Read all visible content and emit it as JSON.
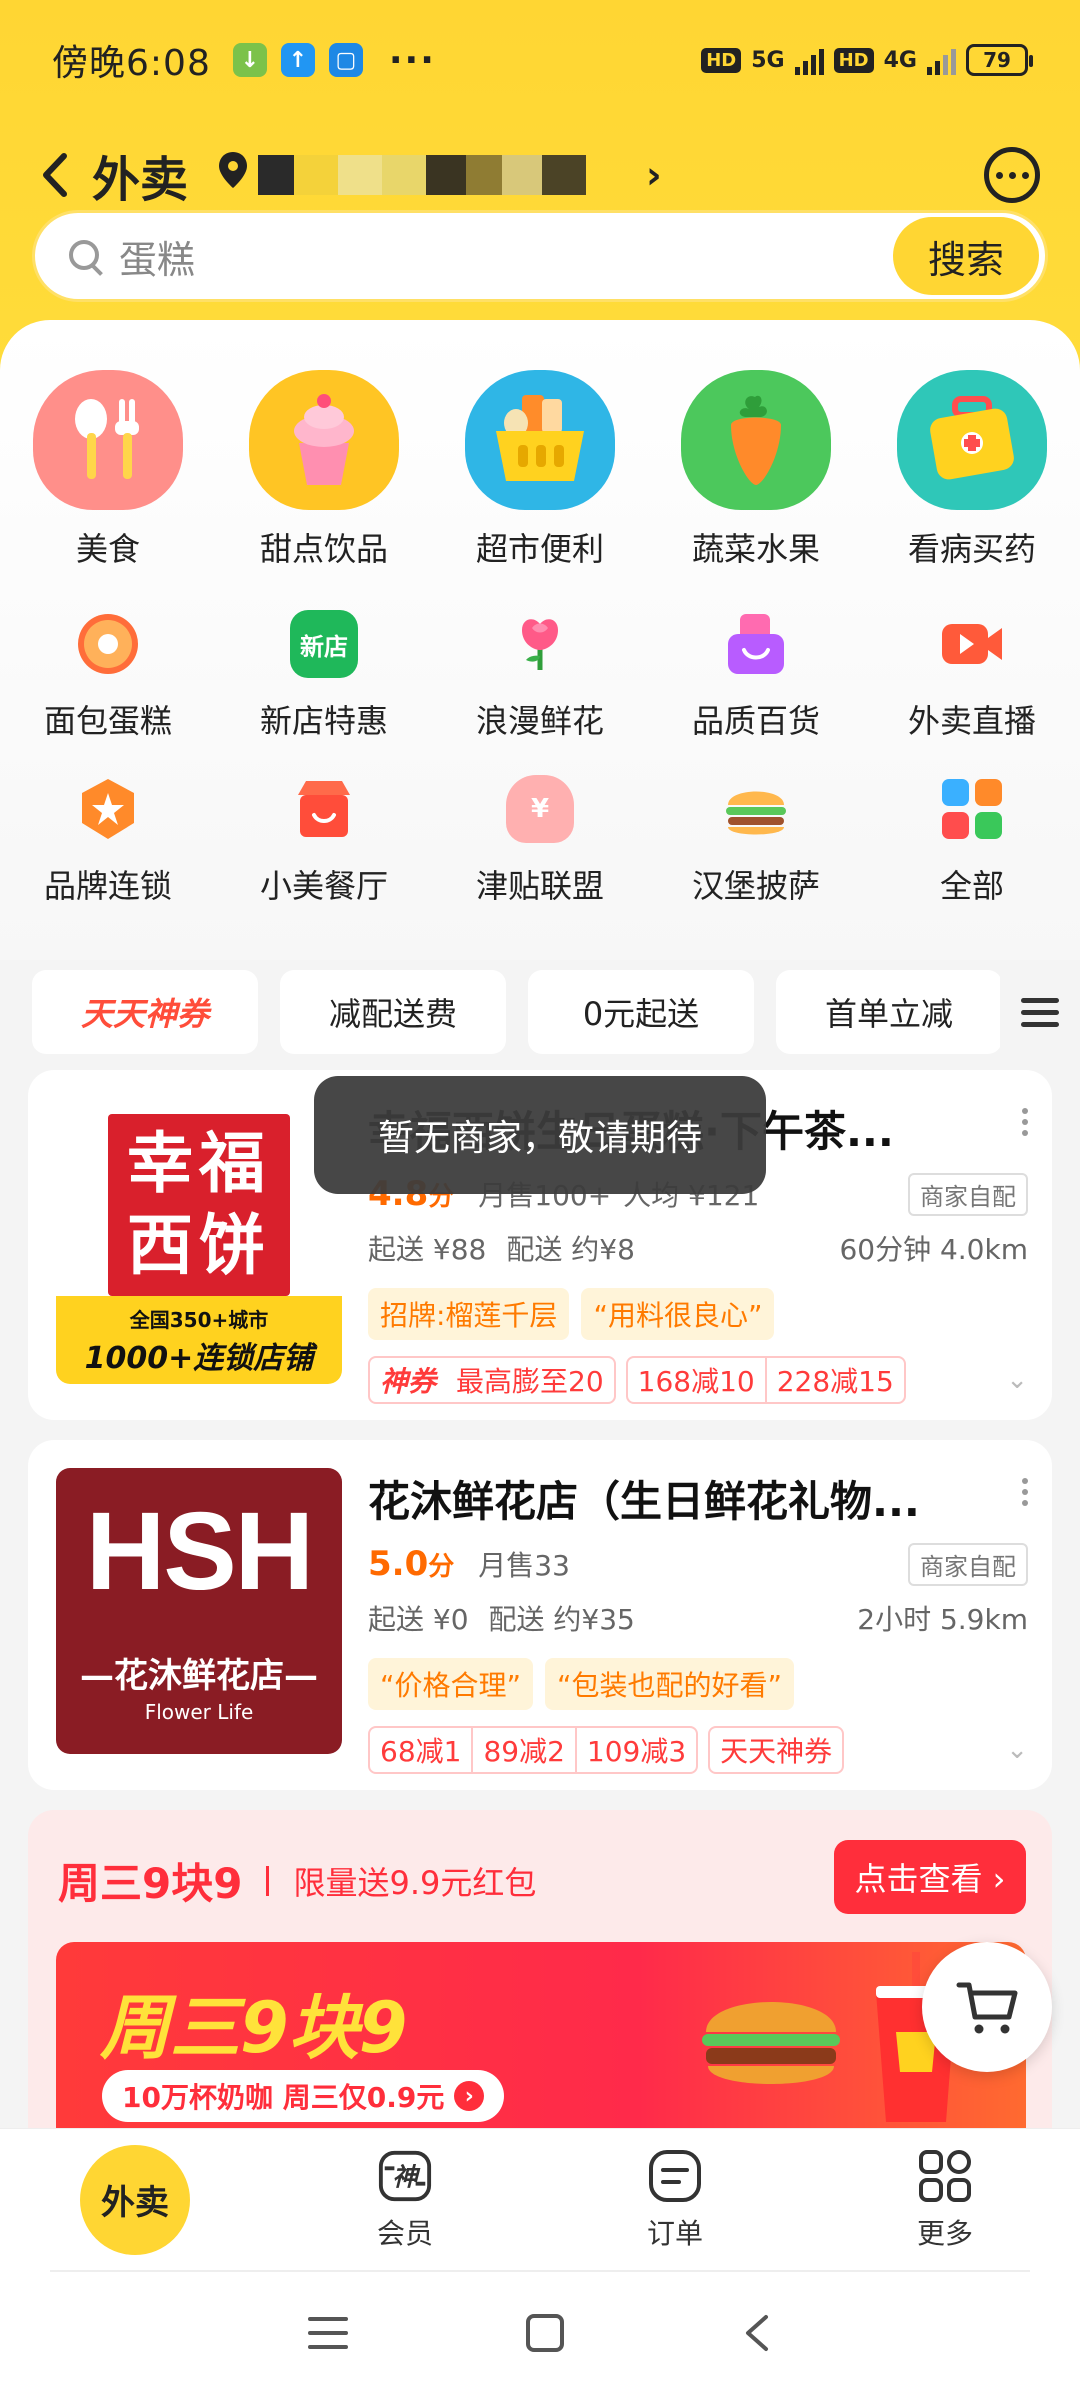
{
  "status_bar": {
    "time": "傍晚6:08",
    "dots": "···",
    "battery": "79",
    "net1": "5G",
    "net2": "4G",
    "hd": "HD"
  },
  "header": {
    "title": "外卖",
    "chevron": "›"
  },
  "search": {
    "placeholder": "蛋糕",
    "button": "搜索"
  },
  "categories_big": [
    {
      "label": "美食",
      "icon": "fork-spoon-icon"
    },
    {
      "label": "甜点饮品",
      "icon": "ice-cream-icon"
    },
    {
      "label": "超市便利",
      "icon": "basket-icon"
    },
    {
      "label": "蔬菜水果",
      "icon": "carrot-icon"
    },
    {
      "label": "看病买药",
      "icon": "medicine-box-icon"
    }
  ],
  "categories_row2": [
    {
      "label": "面包蛋糕",
      "icon": "donut-icon"
    },
    {
      "label": "新店特惠",
      "icon": "new-store-icon",
      "badge": "新店"
    },
    {
      "label": "浪漫鲜花",
      "icon": "rose-icon"
    },
    {
      "label": "品质百货",
      "icon": "shopping-bag-icon"
    },
    {
      "label": "外卖直播",
      "icon": "live-video-icon"
    }
  ],
  "categories_row3": [
    {
      "label": "品牌连锁",
      "icon": "star-badge-icon"
    },
    {
      "label": "小美餐厅",
      "icon": "restaurant-icon"
    },
    {
      "label": "津贴联盟",
      "icon": "money-bag-icon",
      "badge": "¥"
    },
    {
      "label": "汉堡披萨",
      "icon": "burger-icon"
    },
    {
      "label": "全部",
      "icon": "all-grid-icon"
    }
  ],
  "filters": [
    "天天神券",
    "减配送费",
    "0元起送",
    "首单立减"
  ],
  "stores": [
    {
      "name": "幸福西饼生日蛋糕·下午茶...",
      "rating": "4.8",
      "rating_unit": "分",
      "monthly": "月售100+",
      "avg": "人均 ¥121",
      "delivery_type": "商家自配",
      "min_order": "起送 ¥88",
      "fee": "配送 约¥8",
      "time_dist": "60分钟 4.0km",
      "tags": [
        "招牌:榴莲千层",
        "“用料很良心”"
      ],
      "promos_shenquan": [
        "神券",
        "最高膨至20"
      ],
      "promos": [
        "168减10",
        "228减15"
      ],
      "logo_line1": "幸福",
      "logo_line2": "西饼",
      "logo_sub1": "全国350+城市",
      "logo_sub2": "1000+连锁店铺"
    },
    {
      "name": "花沐鲜花店（生日鲜花礼物...",
      "rating": "5.0",
      "rating_unit": "分",
      "monthly": "月售33",
      "delivery_type": "商家自配",
      "min_order": "起送 ¥0",
      "fee": "配送 约¥35",
      "time_dist": "2小时 5.9km",
      "tags": [
        "“价格合理”",
        "“包装也配的好看”"
      ],
      "promos": [
        "68减1",
        "89减2",
        "109减3"
      ],
      "promo_extra": "天天神券",
      "logo_big": "HSH",
      "logo_cn": "—花沐鲜花店—",
      "logo_en": "Flower Life"
    }
  ],
  "toast": "暂无商家，敬请期待",
  "promo": {
    "title": "周三9块9",
    "subtitle": "限量送9.9元红包",
    "cta": "点击查看 ›",
    "banner_title": "周三9块9",
    "banner_pill": "10万杯奶咖 周三仅0.9元",
    "banner_pill_arrow": "›"
  },
  "tabs": [
    {
      "label": "外卖",
      "icon": "waimai-home-icon"
    },
    {
      "label": "会员",
      "icon": "member-shen-icon",
      "glyph": "神"
    },
    {
      "label": "订单",
      "icon": "order-icon"
    },
    {
      "label": "更多",
      "icon": "more-grid-icon"
    }
  ],
  "colors": {
    "brand_yellow": "#ffd633",
    "price_orange": "#ff6a00",
    "promo_red": "#ff2e3b"
  }
}
